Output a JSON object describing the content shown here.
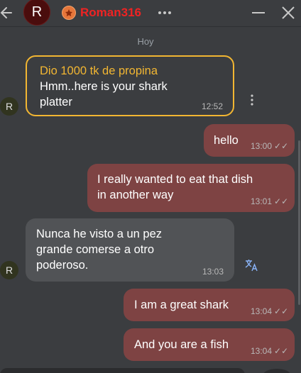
{
  "header": {
    "avatar_letter": "R",
    "username": "Roman316",
    "icons": {
      "back": "arrow-left-icon",
      "badge": "crown-badge-icon",
      "more": "more-horizontal-icon",
      "minimize": "minimize-icon",
      "close": "close-icon"
    }
  },
  "date_separator": "Hoy",
  "messages": [
    {
      "direction": "in",
      "tip_title": "Dio 1000 tk de propina",
      "text_lines": [
        "Hmm..here is your shark",
        "platter"
      ],
      "time": "12:52",
      "avatar": "R"
    },
    {
      "direction": "out",
      "text_lines": [
        "hello"
      ],
      "time": "13:00"
    },
    {
      "direction": "out",
      "text_lines": [
        "I really wanted to eat that dish",
        "in another way"
      ],
      "time": "13:01"
    },
    {
      "direction": "in",
      "text_lines": [
        "Nunca he visto a un pez",
        "grande comerse a otro",
        "poderoso."
      ],
      "time": "13:03",
      "avatar": "R"
    },
    {
      "direction": "out",
      "text_lines": [
        "I am a great shark"
      ],
      "time": "13:04"
    },
    {
      "direction": "out",
      "text_lines": [
        "And you are a fish"
      ],
      "time": "13:04"
    }
  ],
  "colors": {
    "background": "#3b3d40",
    "incoming_bubble": "#515356",
    "outgoing_bubble": "#7e4343",
    "tip_border": "#f2b632",
    "username": "#ef2323"
  }
}
